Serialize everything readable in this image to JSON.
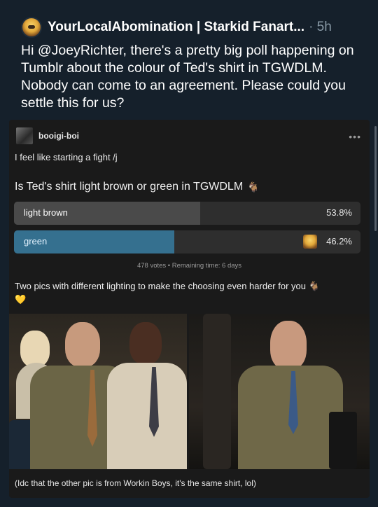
{
  "tweet": {
    "author": "YourLocalAbomination | Starkid Fanart...",
    "separator": "·",
    "time": "5h",
    "text": "Hi @JoeyRichter, there's a pretty big poll happening on Tumblr about the colour of Ted's shirt in TGWDLM. Nobody can come to an agreement. Please could you settle this for us?"
  },
  "tumblr_post": {
    "username": "booigi-boi",
    "more_menu": "•••",
    "line1": "I feel like starting a fight  /j",
    "poll": {
      "question": "Is Ted's shirt light brown or green in TGWDLM",
      "question_emoji": "🐐",
      "options": [
        {
          "label": "light brown",
          "percent_text": "53.8%",
          "percent": 53.8
        },
        {
          "label": "green",
          "percent_text": "46.2%",
          "percent": 46.2
        }
      ],
      "meta": "478 votes • Remaining time: 6 days"
    },
    "caption": "Two pics with different lighting to make the choosing even harder for you",
    "caption_emoji_1": "🐐",
    "caption_emoji_2": "💛",
    "bottom_caption": "(Idc that the other pic is from Workin Boys, it's the same shirt, lol)"
  },
  "colors": {
    "background": "#15202b",
    "tumblr_background": "#1a1a1a",
    "poll_fill_brown": "#4a4a4a",
    "poll_fill_green": "#35708f"
  }
}
